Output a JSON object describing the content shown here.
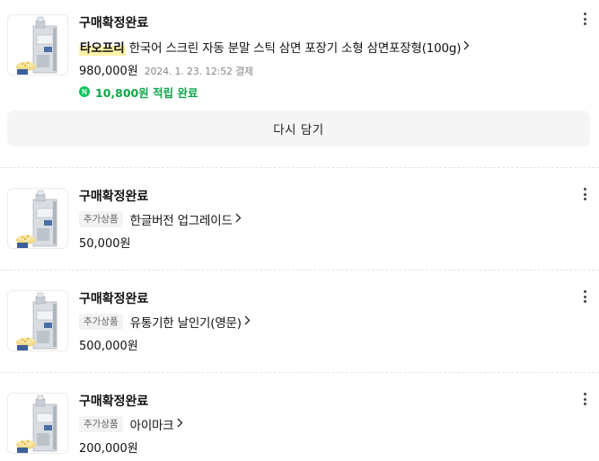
{
  "orders": [
    {
      "status": "구매확정완료",
      "brand": "타오프리",
      "product_name": "한국어 스크린 자동 분말 스틱 삼면 포장기 소형 삼면포장형(100g)",
      "tag": "",
      "price": "980,000원",
      "date": "2024. 1. 23. 12:52 결제",
      "points": "10,800원 적립 완료",
      "npay_icon": "N",
      "rebuy_label": "다시 담기"
    },
    {
      "status": "구매확정완료",
      "tag": "추가상품",
      "product_name": "한글버전 업그레이드",
      "price": "50,000원"
    },
    {
      "status": "구매확정완료",
      "tag": "추가상품",
      "product_name": "유통기한 날인기(영문)",
      "price": "500,000원"
    },
    {
      "status": "구매확정완료",
      "tag": "추가상품",
      "product_name": "아이마크",
      "price": "200,000원"
    }
  ],
  "icons": {
    "more": "more-vertical-icon",
    "chevron": "chevron-right-icon",
    "npay": "naver-pay-icon"
  },
  "colors": {
    "point_green": "#10a64a",
    "npay_green": "#03c75a",
    "brand_highlight": "#fff2a8"
  }
}
